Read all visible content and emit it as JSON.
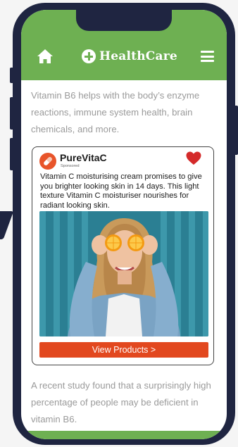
{
  "header": {
    "brand_name": "HealthCare"
  },
  "article": {
    "paragraph_1": "Vitamin B6 helps with the body’s enzyme reactions, immune system health, brain chemicals, and more.",
    "paragraph_2": "A recent study found that a surprisingly high percentage of people may be deficient in vitamin B6."
  },
  "ad": {
    "brand": "PureVitaC",
    "sponsored_label": "Sponsored",
    "body_text": "Vitamin C moisturising cream promises to give you brighter looking skin in 14 days. This light texture Vitamin C moisturiser nourishes for radiant looking skin.",
    "button_label": "View Products >"
  },
  "colors": {
    "header_green": "#6eb052",
    "phone_navy": "#1f2541",
    "cta_orange": "#e2481f",
    "heart_red": "#d42a2a"
  },
  "icons": [
    "home-icon",
    "plus-circle-icon",
    "menu-icon",
    "heart-icon",
    "pill-icon"
  ]
}
